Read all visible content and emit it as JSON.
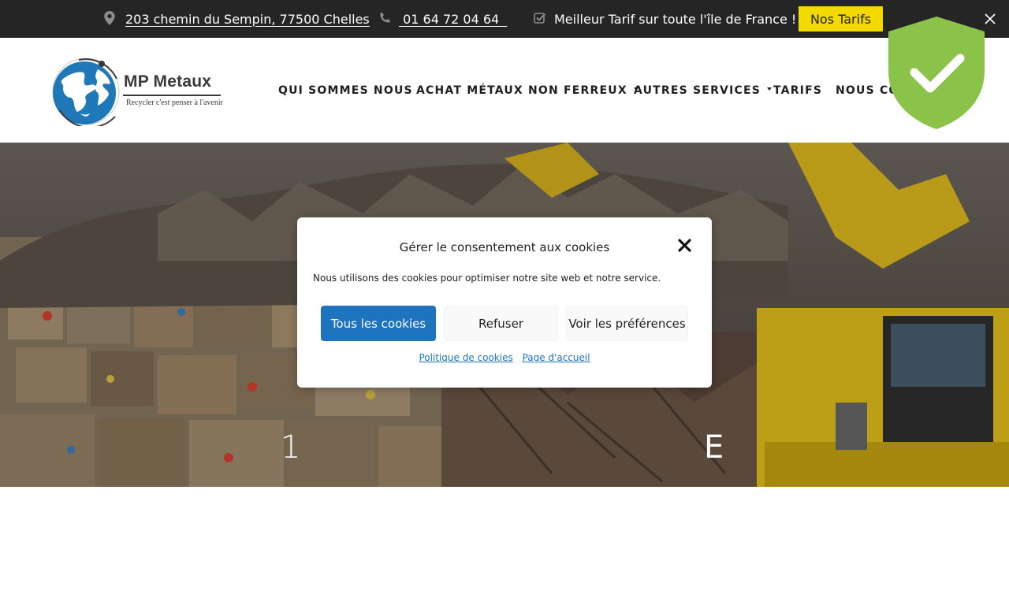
{
  "topbar": {
    "address": "203 chemin du Sempin, 77500 Chelles",
    "phone": " 01 64 72 04 64  ",
    "promo": "Meilleur Tarif sur toute l'île de France !",
    "tarifs_button": "Nos Tarifs",
    "icons": {
      "address": "map-marker-icon",
      "phone": "phone-icon",
      "promo": "check-square-icon",
      "close": "close-icon"
    }
  },
  "header": {
    "logo_title": "MP Metaux",
    "logo_tagline": "Recycler c'est penser à l'avenir",
    "nav": [
      {
        "label": "QUI SOMMES NOUS",
        "has_dropdown": false
      },
      {
        "label": "ACHAT MÉTAUX NON FERREUX",
        "has_dropdown": true
      },
      {
        "label": "AUTRES SERVICES",
        "has_dropdown": true
      },
      {
        "label": "TARIFS",
        "has_dropdown": false
      },
      {
        "label": "NOUS CO",
        "has_dropdown": false
      }
    ]
  },
  "hero": {
    "title_left_fragment": "1",
    "title_right_fragment": "E"
  },
  "cookie_modal": {
    "title": "Gérer le consentement aux cookies",
    "message": "Nous utilisons des cookies pour optimiser notre site web et notre service.",
    "accept_button": "Tous les cookies",
    "refuse_button": "Refuser",
    "preferences_button": "Voir les préférences",
    "links": [
      "Politique de cookies",
      "Page d'accueil"
    ]
  },
  "colors": {
    "topbar_bg": "#252525",
    "tarifs_button_bg": "#f3d900",
    "accept_button_bg": "#1e73be",
    "shield_green": "#8bc34a",
    "link_color": "#1e73be"
  }
}
